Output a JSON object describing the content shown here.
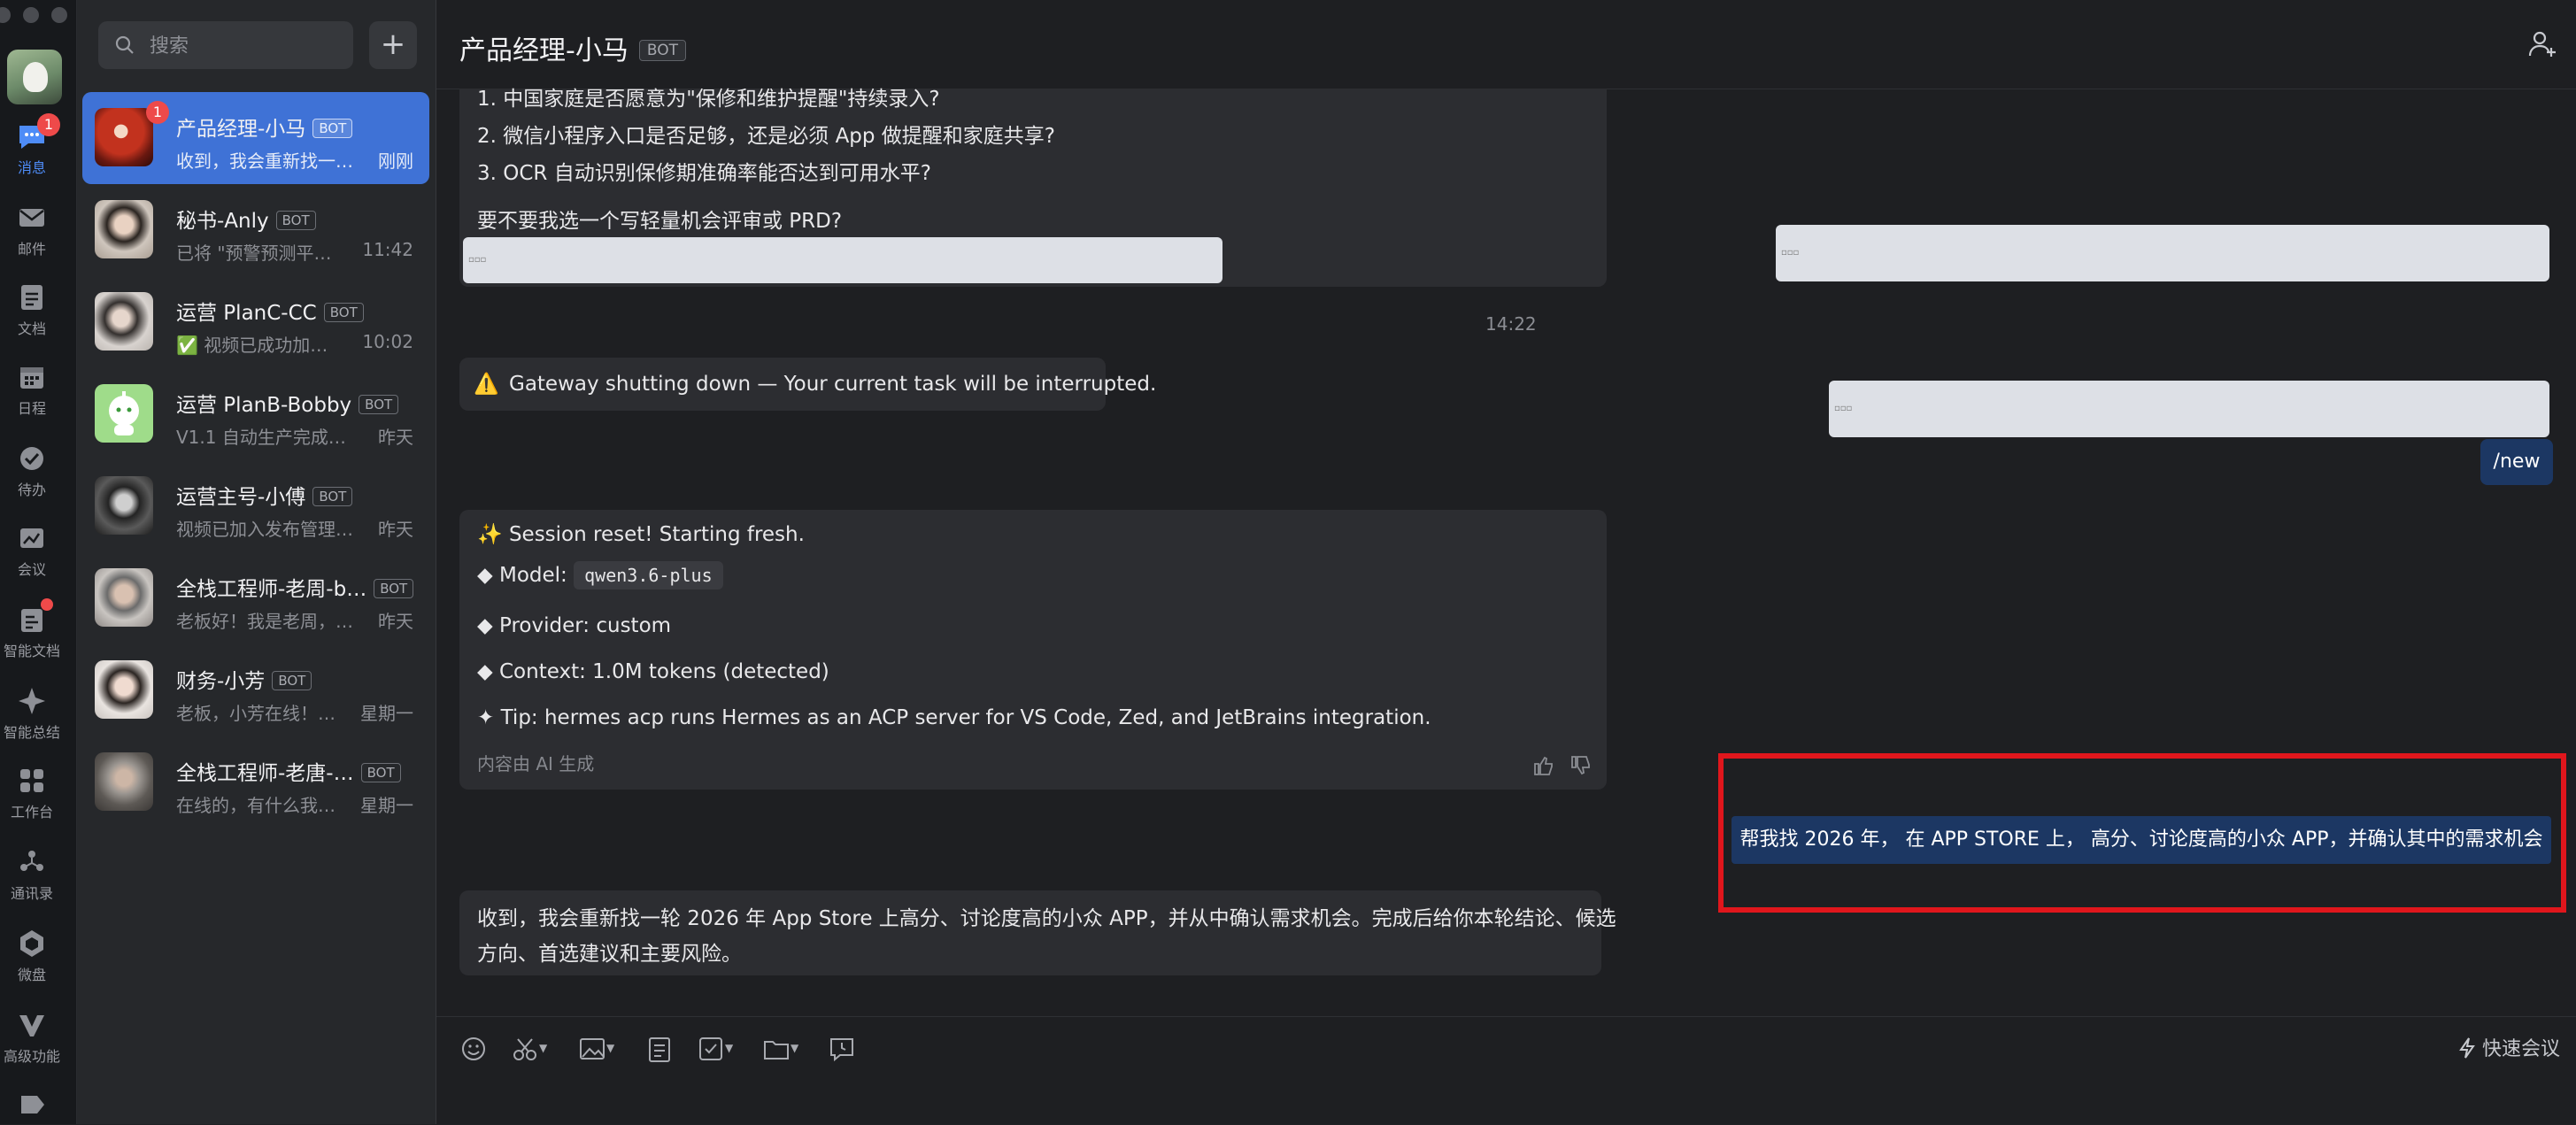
{
  "rail": {
    "items": [
      {
        "label": "消息",
        "icon": "chat-bubble-icon",
        "badge": "1",
        "active": true
      },
      {
        "label": "邮件",
        "icon": "mail-icon"
      },
      {
        "label": "文档",
        "icon": "document-icon"
      },
      {
        "label": "日程",
        "icon": "calendar-icon"
      },
      {
        "label": "待办",
        "icon": "todo-check-icon"
      },
      {
        "label": "会议",
        "icon": "meeting-icon"
      },
      {
        "label": "智能文档",
        "icon": "smart-doc-icon"
      },
      {
        "label": "智能总结",
        "icon": "sparkle-icon"
      },
      {
        "label": "工作台",
        "icon": "workbench-grid-icon"
      },
      {
        "label": "通讯录",
        "icon": "contacts-icon"
      },
      {
        "label": "微盘",
        "icon": "drive-icon"
      },
      {
        "label": "高级功能",
        "icon": "advanced-v-icon"
      }
    ]
  },
  "search": {
    "placeholder": "搜索"
  },
  "conversations": [
    {
      "name": "产品经理-小马",
      "tag": "BOT",
      "preview": "收到，我会重新找一…",
      "time": "刚刚",
      "badge": "1",
      "active": true
    },
    {
      "name": "秘书-Anly",
      "tag": "BOT",
      "preview": "已将 \"预警预测平…",
      "time": "11:42"
    },
    {
      "name": "运营 PlanC-CC",
      "tag": "BOT",
      "preview": "✅ 视频已成功加…",
      "time": "10:02"
    },
    {
      "name": "运营 PlanB-Bobby",
      "tag": "BOT",
      "preview": "V1.1 自动生产完成：…",
      "time": "昨天"
    },
    {
      "name": "运营主号-小傅",
      "tag": "BOT",
      "preview": "视频已加入发布管理…",
      "time": "昨天"
    },
    {
      "name": "全栈工程师-老周-b…",
      "tag": "BOT",
      "preview": "老板好！我是老周，…",
      "time": "昨天"
    },
    {
      "name": "财务-小芳",
      "tag": "BOT",
      "preview": "老板，小芳在线！…",
      "time": "星期一"
    },
    {
      "name": "全栈工程师-老唐-…",
      "tag": "BOT",
      "preview": "在线的，有什么我…",
      "time": "星期一"
    }
  ],
  "chat": {
    "title": "产品经理-小马",
    "tag": "BOT",
    "msg1": {
      "lines": [
        "1.  中国家庭是否愿意为\"保修和维护提醒\"持续录入?",
        "2.  微信小程序入口是否足够，还是必须 App 做提醒和家庭共享?",
        "3.  OCR 自动识别保修期准确率能否达到可用水平?",
        "要不要我选一个写轻量机会评审或 PRD?"
      ]
    },
    "timestamp": "14:22",
    "warning": {
      "icon": "⚠️",
      "text": "Gateway shutting down — Your current task will be interrupted."
    },
    "user_new": "/new",
    "session": {
      "line1": "✨ Session reset! Starting fresh.",
      "model_label": "◆ Model:",
      "model_value": "qwen3.6-plus",
      "provider": "◆ Provider: custom",
      "context": "◆ Context: 1.0M tokens (detected)",
      "tip": "✦ Tip: hermes acp runs Hermes as an ACP server for VS Code, Zed, and JetBrains integration.",
      "ai_note": "内容由 AI 生成"
    },
    "user_request": "帮我找 2026 年， 在 APP STORE 上， 高分、讨论度高的小众 APP，并确认其中的需求机会",
    "reply": {
      "line1": "收到，我会重新找一轮 2026 年 App Store 上高分、讨论度高的小众 APP，并从中确认需求机会。完成后给你本轮结论、候选",
      "line2": "方向、首选建议和主要风险。"
    }
  },
  "composer": {
    "tools": [
      "emoji-icon",
      "scissors-icon",
      "image-icon",
      "note-icon",
      "checkbox-icon",
      "folder-icon",
      "history-chat-icon"
    ],
    "quick_meeting": "快速会议"
  },
  "colors": {
    "accent": "#3f72d6",
    "user_bubble": "#1c3763",
    "highlight": "#e0161c",
    "badge": "#ee4a4a"
  }
}
